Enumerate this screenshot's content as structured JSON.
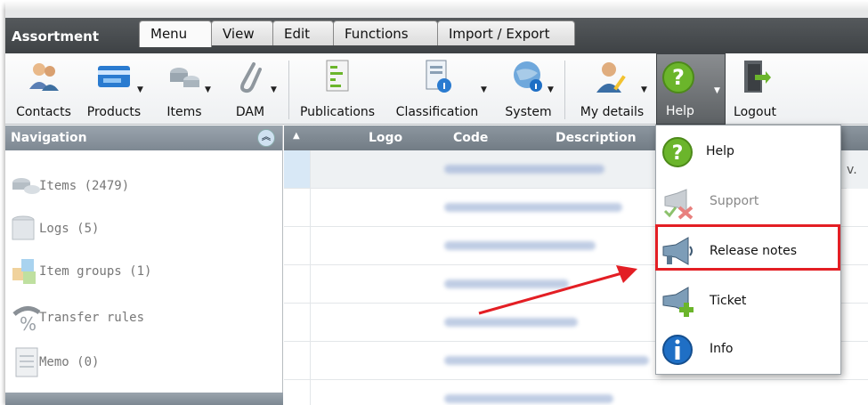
{
  "app": {
    "title": "Assortment"
  },
  "tabs": [
    {
      "label": "Menu",
      "active": true
    },
    {
      "label": "View"
    },
    {
      "label": "Edit"
    },
    {
      "label": "Functions"
    },
    {
      "label": "Import / Export"
    }
  ],
  "ribbon": {
    "contacts": "Contacts",
    "products": "Products",
    "items": "Items",
    "dam": "DAM",
    "publications": "Publications",
    "classification": "Classification",
    "system": "System",
    "my_details": "My details",
    "help": "Help",
    "logout": "Logout"
  },
  "navigation": {
    "title": "Navigation",
    "items": [
      {
        "label": "Items (2479)",
        "icon": "items-icon"
      },
      {
        "label": "Logs (5)",
        "icon": "logs-icon"
      },
      {
        "label": "Item groups (1)",
        "icon": "item-groups-icon"
      },
      {
        "label": "Transfer rules",
        "icon": "transfer-rules-icon"
      },
      {
        "label": "Memo (0)",
        "icon": "memo-icon"
      }
    ]
  },
  "grid": {
    "columns": {
      "logo": "Logo",
      "code": "Code",
      "description": "Description"
    },
    "partial_text": {
      "row1_right": "v."
    }
  },
  "help_menu": {
    "items": [
      {
        "label": "Help",
        "icon": "help-icon",
        "enabled": true
      },
      {
        "label": "Support",
        "icon": "support-icon",
        "enabled": false
      },
      {
        "label": "Release notes",
        "icon": "release-notes-icon",
        "enabled": true,
        "highlighted": true
      },
      {
        "label": "Ticket",
        "icon": "ticket-icon",
        "enabled": true
      },
      {
        "label": "Info",
        "icon": "info-icon",
        "enabled": true
      }
    ]
  },
  "colors": {
    "highlight": "#e31e24",
    "arrow": "#e31e24",
    "help_green": "#6bb52b",
    "info_blue": "#1f6fc5"
  }
}
